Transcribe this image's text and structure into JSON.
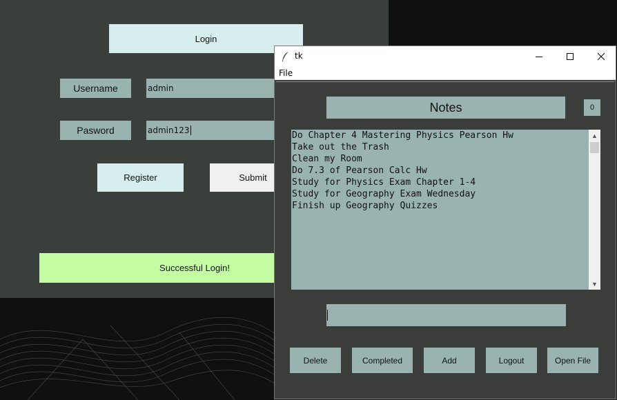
{
  "login_window": {
    "header_button": "Login",
    "username_label": "Username",
    "username_value": "admin",
    "password_label": "Pasword",
    "password_value": "admin123",
    "register_button": "Register",
    "submit_button": "Submit",
    "status_message": "Successful Login!"
  },
  "notes_window": {
    "title": "tk",
    "icon": "feather-icon",
    "menu": [
      "File"
    ],
    "header": "Notes",
    "count": "0",
    "notes": [
      "Do Chapter 4 Mastering Physics Pearson Hw",
      "Take out the Trash",
      "Clean my Room",
      "Do 7.3 of Pearson Calc Hw",
      "Study for Physics Exam Chapter 1-4",
      "Study for Geography Exam Wednesday",
      "Finish up Geography Quizzes"
    ],
    "input_value": "",
    "buttons": {
      "delete": "Delete",
      "completed": "Completed",
      "add": "Add",
      "logout": "Logout",
      "open_file": "Open File"
    }
  },
  "colors": {
    "window_bg": "#3b3f3b",
    "widget_bg": "#99b3b1",
    "light_button": "#d6eeee",
    "success": "#c4fca4"
  }
}
